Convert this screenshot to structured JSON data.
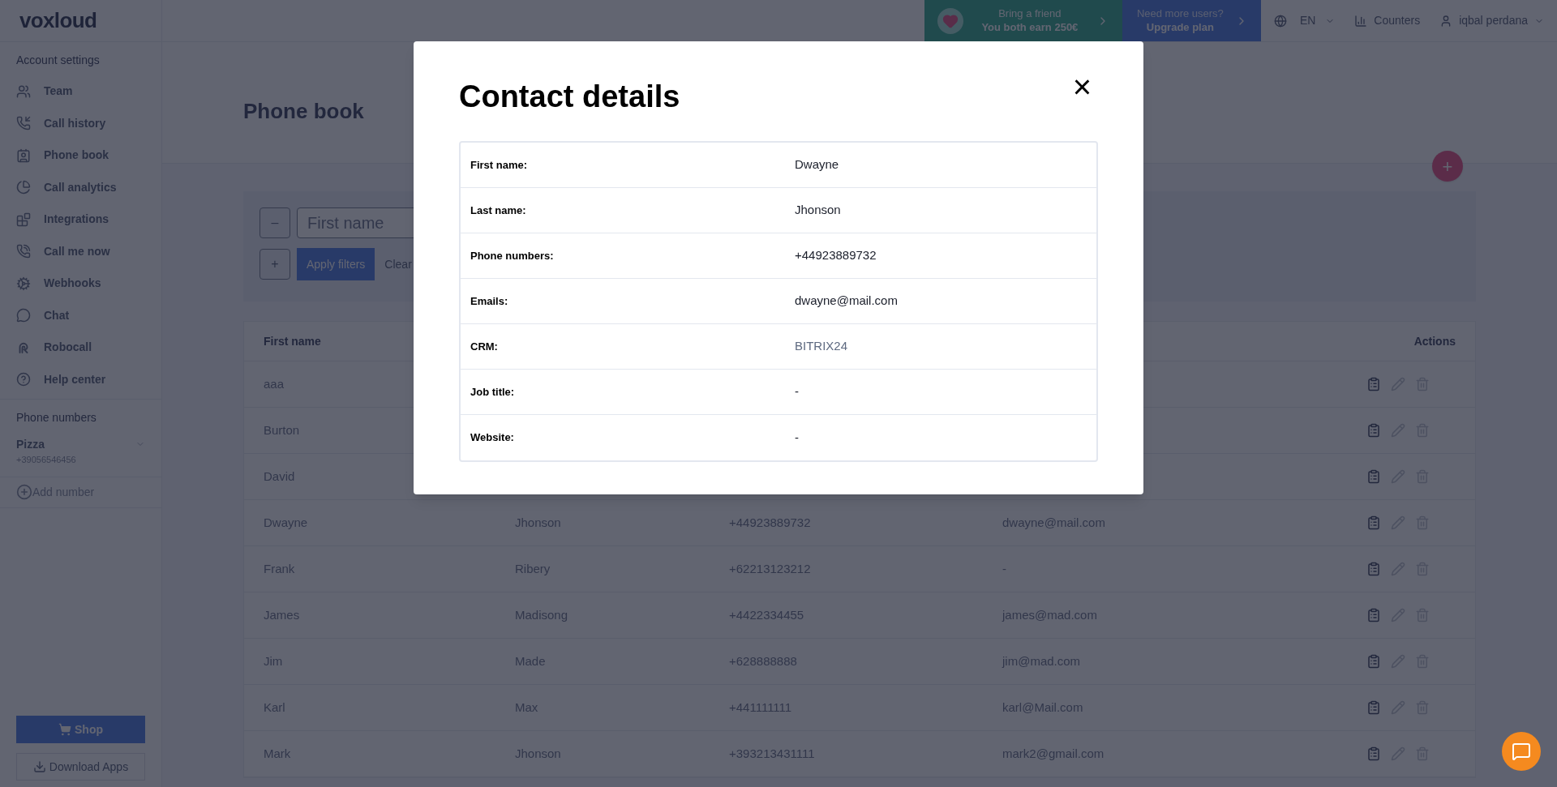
{
  "logo": "voxloud",
  "sidebar": {
    "section_title": "Account settings",
    "items": [
      {
        "label": "Team"
      },
      {
        "label": "Call history"
      },
      {
        "label": "Phone book"
      },
      {
        "label": "Call analytics"
      },
      {
        "label": "Integrations"
      },
      {
        "label": "Call me now"
      },
      {
        "label": "Webhooks"
      },
      {
        "label": "Chat"
      },
      {
        "label": "Robocall"
      },
      {
        "label": "Help center"
      }
    ],
    "numbers_title": "Phone numbers",
    "numbers": [
      {
        "name": "Pizza",
        "number": "+39056546456"
      }
    ],
    "add_number": "Add number",
    "shop_button": "Shop",
    "download_button": "Download Apps"
  },
  "top_bar": {
    "referral": {
      "line1": "Bring a friend",
      "line2": "You both earn 250€"
    },
    "upgrade": {
      "line1": "Need more users?",
      "line2": "Upgrade plan"
    },
    "language": "EN",
    "counters": "Counters",
    "user": "iqbal perdana"
  },
  "page_title": "Phone book",
  "filters": {
    "remove": "–",
    "field_placeholder": "First name",
    "add": "+",
    "apply": "Apply filters",
    "clear": "Clear"
  },
  "add_contact": "+",
  "table": {
    "first_header": "First name",
    "actions_header": "Actions",
    "rows": [
      {
        "cells": [
          "aaa"
        ]
      },
      {
        "cells": [
          "Burton"
        ]
      },
      {
        "cells": [
          "David"
        ]
      },
      {
        "cells": [
          "Dwayne",
          "Jhonson",
          "+44923889732",
          "dwayne@mail.com"
        ]
      },
      {
        "cells": [
          "Frank",
          "Ribery",
          "+62213123212",
          "-"
        ]
      },
      {
        "cells": [
          "James",
          "Madisong",
          "+4422334455",
          "james@mad.com"
        ]
      },
      {
        "cells": [
          "Jim",
          "Made",
          "+628888888",
          "jim@mad.com"
        ]
      },
      {
        "cells": [
          "Karl",
          "Max",
          "+441111111",
          "karl@Mail.com"
        ]
      },
      {
        "cells": [
          "Mark",
          "Jhonson",
          "+393213431111",
          "mark2@gmail.com"
        ]
      }
    ]
  },
  "modal": {
    "title": "Contact details",
    "close": "×",
    "fields": [
      {
        "label": "First name:",
        "value": "Dwayne",
        "kind": "text"
      },
      {
        "label": "Last name:",
        "value": "Jhonson",
        "kind": "text"
      },
      {
        "label": "Phone numbers:",
        "value": "+44923889732",
        "kind": "text"
      },
      {
        "label": "Emails:",
        "value": "dwayne@mail.com",
        "kind": "text"
      },
      {
        "label": "CRM:",
        "value": "BITRIX24",
        "kind": "link"
      },
      {
        "label": "Job title:",
        "value": "-",
        "kind": "text"
      },
      {
        "label": "Website:",
        "value": "-",
        "kind": "text"
      }
    ]
  }
}
